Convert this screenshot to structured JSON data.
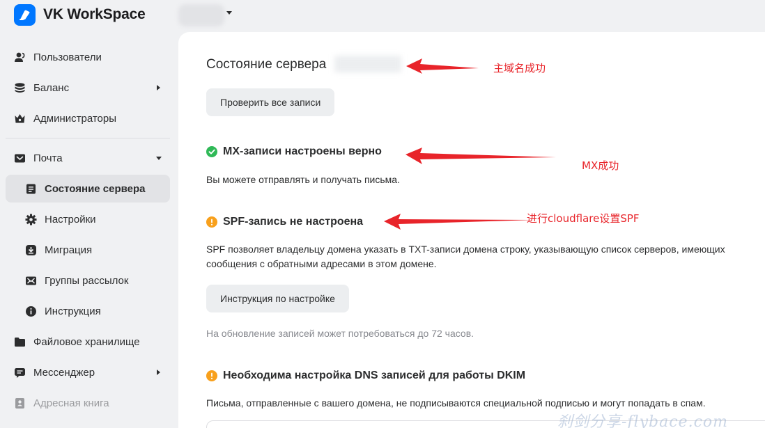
{
  "app": {
    "title": "VK WorkSpace",
    "brand_color": "#0077ff"
  },
  "sidebar": {
    "items": [
      {
        "label": "Пользователи",
        "icon": "users-icon"
      },
      {
        "label": "Баланс",
        "icon": "coins-icon"
      },
      {
        "label": "Администраторы",
        "icon": "crown-icon"
      },
      {
        "label": "Почта",
        "icon": "mail-icon"
      },
      {
        "label": "Состояние сервера",
        "icon": "server-status-icon"
      },
      {
        "label": "Настройки",
        "icon": "gear-icon"
      },
      {
        "label": "Миграция",
        "icon": "migration-icon"
      },
      {
        "label": "Группы рассылок",
        "icon": "mailing-groups-icon"
      },
      {
        "label": "Инструкция",
        "icon": "info-icon"
      },
      {
        "label": "Файловое хранилище",
        "icon": "folder-icon"
      },
      {
        "label": "Мессенджер",
        "icon": "messenger-icon"
      },
      {
        "label": "Адресная книга",
        "icon": "address-book-icon"
      }
    ],
    "active": "Состояние сервера"
  },
  "main": {
    "title": "Состояние сервера",
    "check_all_button": "Проверить все записи",
    "mx": {
      "title": "MX-записи настроены верно",
      "text": "Вы можете отправлять и получать письма.",
      "status_color": "#2fb957"
    },
    "spf": {
      "title": "SPF-запись не настроена",
      "text_line1": "SPF позволяет владельцу домена указать в TXT-записи домена строку, указывающую список серверов, имеющих",
      "text_line2": "сообщения с обратными адресами в этом домене.",
      "button": "Инструкция по настройке",
      "note": "На обновление записей может потребоваться до 72 часов.",
      "status_color": "#f8a01c"
    },
    "dkim": {
      "title": "Необходима настройка DNS записей для работы DKIM",
      "text": "Письма, отправленные с вашего домена, не подписываются специальной подписью и могут попадать в спам.",
      "status_color": "#f8a01c"
    }
  },
  "annotations": {
    "a1": "主域名成功",
    "a2": "MX成功",
    "a3": "进行cloudflare设置SPF",
    "color": "#e8242a"
  },
  "watermark": "刹剑分享-flybace.com"
}
